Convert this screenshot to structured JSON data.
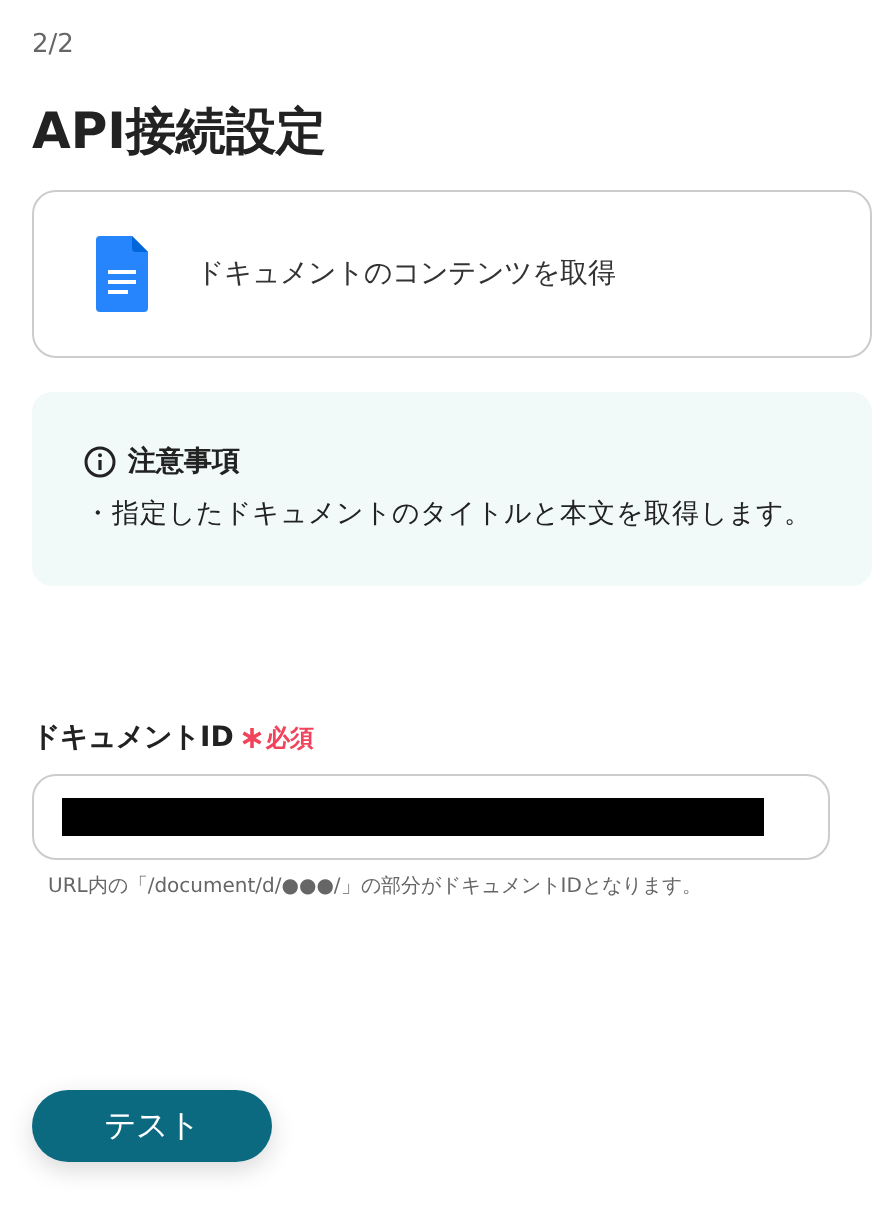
{
  "step": "2/2",
  "title": "API接続設定",
  "action": {
    "label": "ドキュメントのコンテンツを取得"
  },
  "notice": {
    "title": "注意事項",
    "items": [
      "・指定したドキュメントのタイトルと本文を取得します。"
    ]
  },
  "field": {
    "label": "ドキュメントID",
    "required": true,
    "required_label": "必須",
    "redacted": true,
    "hint": "URL内の「/document/d/●●●/」の部分がドキュメントIDとなります。"
  },
  "button": {
    "label": "テスト"
  }
}
